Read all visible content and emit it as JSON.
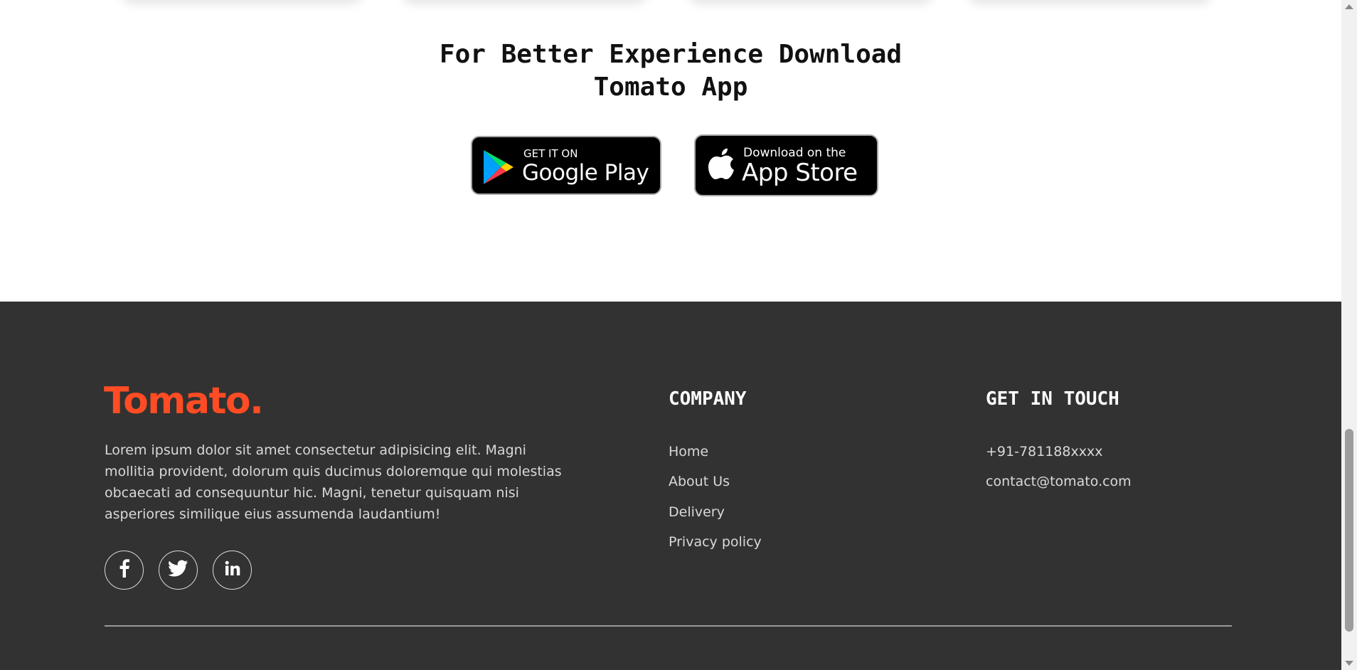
{
  "app_download": {
    "title_line1": "For Better Experience Download",
    "title_line2": "Tomato App",
    "google_play": {
      "small": "GET IT ON",
      "big": "Google Play",
      "icon": "google-play-icon"
    },
    "app_store": {
      "small": "Download on the",
      "big": "App Store",
      "icon": "apple-icon"
    }
  },
  "footer": {
    "logo": "Tomato.",
    "about": "Lorem ipsum dolor sit amet consectetur adipisicing elit. Magni mollitia provident, dolorum quis ducimus doloremque qui molestias obcaecati ad consequuntur hic. Magni, tenetur quisquam nisi asperiores similique eius assumenda laudantium!",
    "social": [
      {
        "icon": "facebook-icon"
      },
      {
        "icon": "twitter-icon"
      },
      {
        "icon": "linkedin-icon"
      }
    ],
    "company": {
      "title": "COMPANY",
      "links": [
        "Home",
        "About Us",
        "Delivery",
        "Privacy policy"
      ]
    },
    "contact": {
      "title": "GET IN TOUCH",
      "phone": "+91-781188xxxx",
      "email": "contact@tomato.com"
    }
  },
  "colors": {
    "brand": "#ff4c24",
    "footer_bg": "#323232",
    "footer_text": "#d9d9d9"
  }
}
